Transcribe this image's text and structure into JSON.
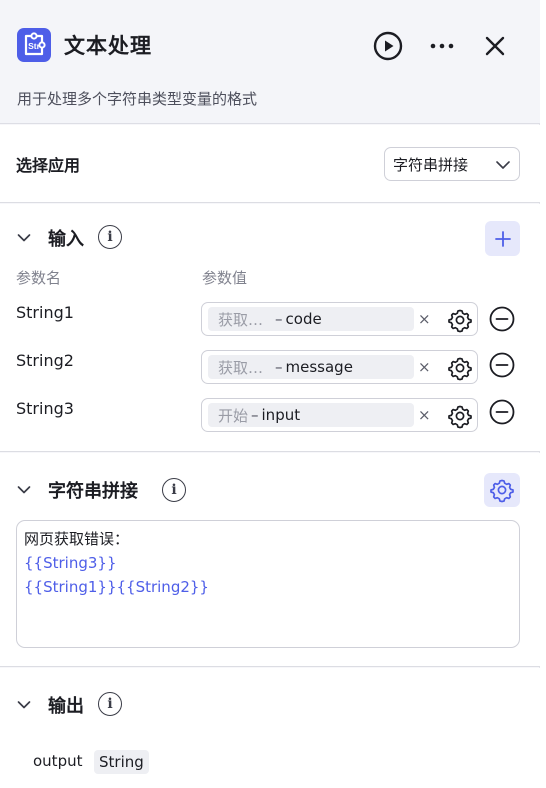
{
  "node": {
    "title": "文本处理",
    "subtitle": "用于处理多个字符串类型变量的格式",
    "icon": "string-tool-icon",
    "accent_color": "#4e5ee8"
  },
  "header_actions": [
    "play-icon",
    "more-icon",
    "close-icon"
  ],
  "app_select": {
    "label": "选择应用",
    "value": "字符串拼接"
  },
  "input_section": {
    "title": "输入",
    "col_name": "参数名",
    "col_value": "参数值",
    "params": [
      {
        "name": "String1",
        "source": "获取…",
        "var": "code"
      },
      {
        "name": "String2",
        "source": "获取…",
        "var": "message"
      },
      {
        "name": "String3",
        "source": "开始",
        "var": "input"
      }
    ],
    "dash": "–",
    "clear_glyph": "×"
  },
  "concat_section": {
    "title": "字符串拼接",
    "template_lines": [
      {
        "text": "网页获取错误：",
        "is_var": false
      },
      {
        "text": "{{String3}}",
        "is_var": true
      },
      {
        "text": "{{String1}}{{String2}}",
        "is_var": true
      }
    ]
  },
  "output_section": {
    "title": "输出",
    "name": "output",
    "type": "String"
  }
}
